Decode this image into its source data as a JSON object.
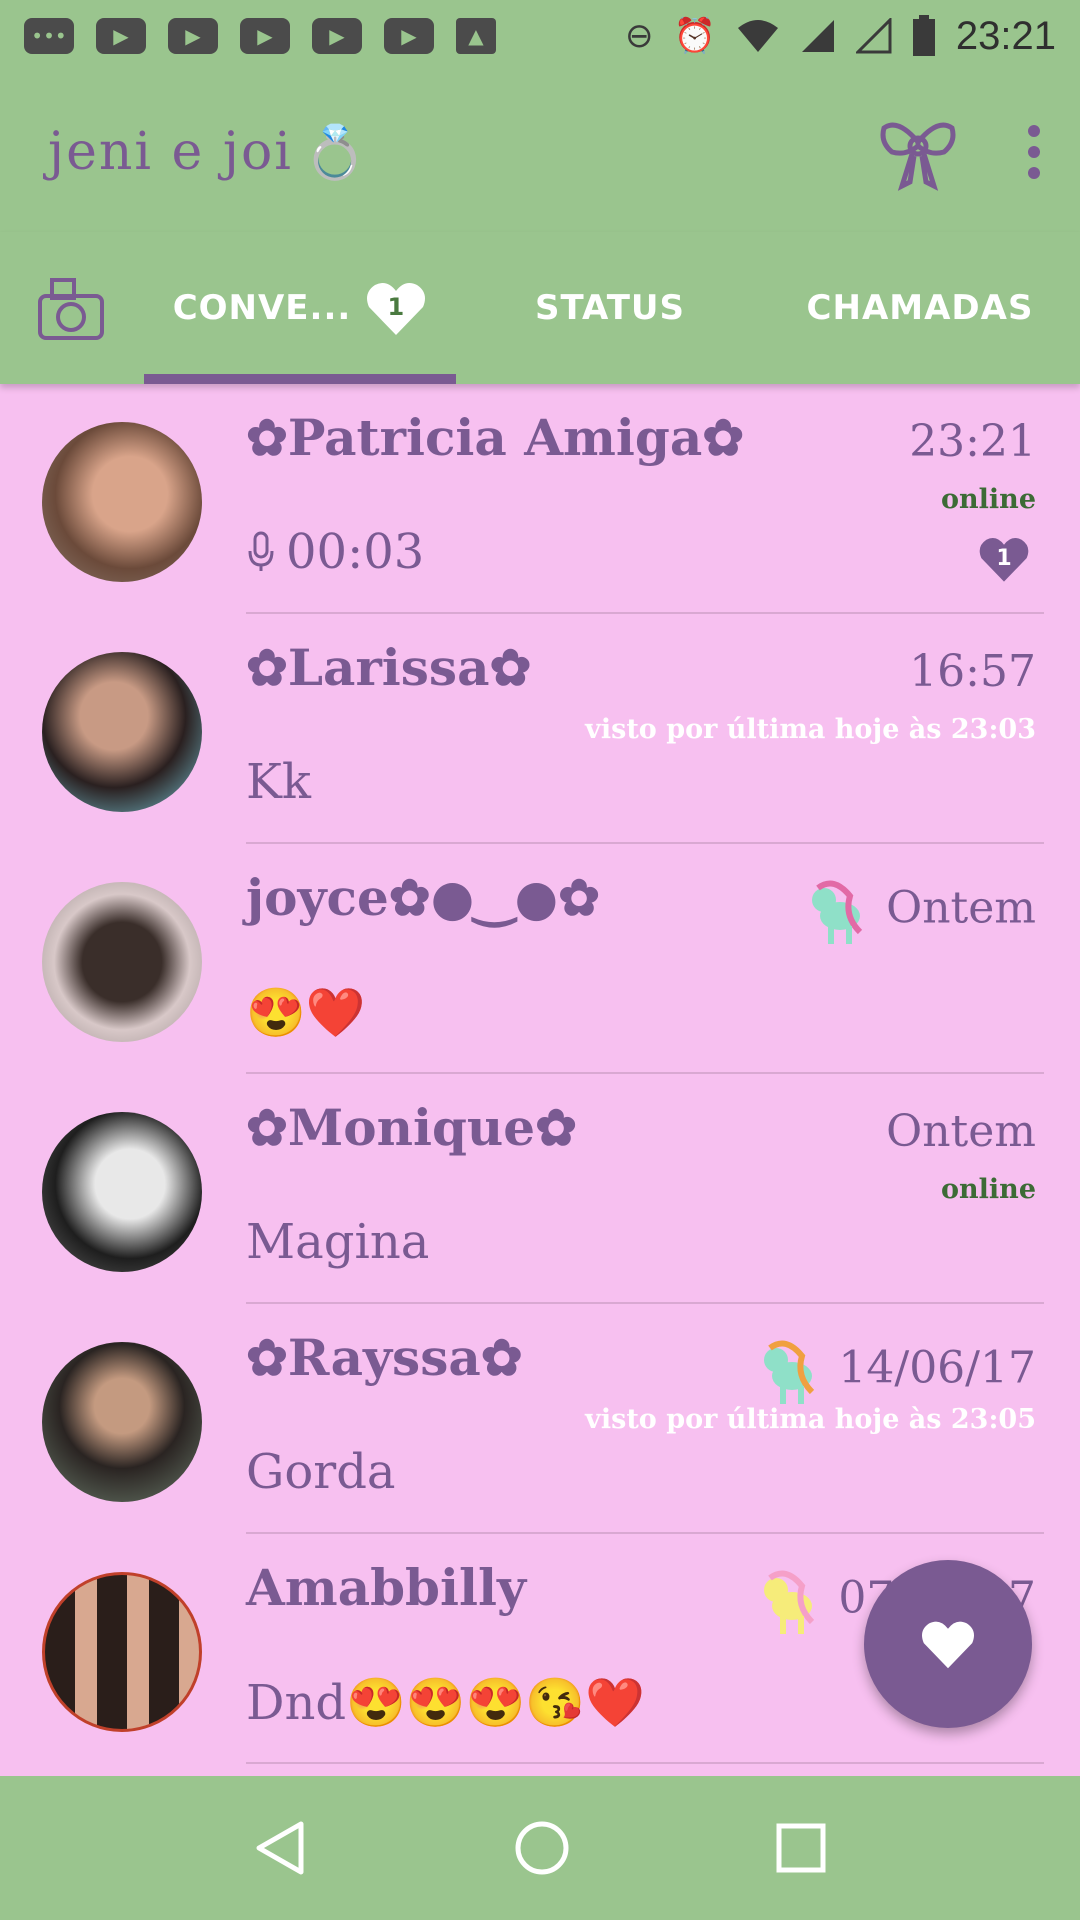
{
  "status_bar": {
    "time": "23:21",
    "left_icons": [
      "messenger-icon",
      "youtube-icon",
      "youtube-icon",
      "youtube-icon",
      "youtube-icon",
      "youtube-icon",
      "gallery-icon"
    ],
    "right_icons": [
      "do-not-disturb-icon",
      "alarm-icon",
      "wifi-icon",
      "signal-icon",
      "signal-empty-icon",
      "battery-icon"
    ]
  },
  "app_bar": {
    "title": "jeni e joi",
    "title_emoji": "💍",
    "actions": [
      "bow-icon",
      "more-options-icon"
    ]
  },
  "tabs": {
    "items": [
      {
        "label": "CONVE...",
        "badge": "1",
        "selected": true
      },
      {
        "label": "STATUS",
        "selected": false
      },
      {
        "label": "CHAMADAS",
        "selected": false
      }
    ]
  },
  "chats": [
    {
      "name": "✿Patricia Amiga✿",
      "time": "23:21",
      "presence": "online",
      "message": "00:03",
      "message_icon": "microphone-icon",
      "unread": "1"
    },
    {
      "name": "✿Larissa✿",
      "time": "16:57",
      "last_seen": "visto por última hoje às 23:03",
      "message": "Kk"
    },
    {
      "name": "joyce✿●‿●✿",
      "time": "Ontem",
      "sticker": "pony-icon",
      "message": "😍❤️"
    },
    {
      "name": "✿Monique✿",
      "time": "Ontem",
      "presence": "online",
      "message": "Magina"
    },
    {
      "name": "✿Rayssa✿",
      "time": "14/06/17",
      "sticker": "pony-icon",
      "last_seen": "visto por última hoje às 23:05",
      "message": "Gorda"
    },
    {
      "name": "Amabbilly",
      "time": "07/06/17",
      "sticker": "pony-icon",
      "message": "Dnd😍😍😍😘❤️"
    }
  ],
  "colors": {
    "header_bg": "#9ac58e",
    "list_bg": "#f7c0f0",
    "accent": "#7a5a92",
    "online": "#3d6b36"
  },
  "fab": {
    "icon": "heart-chat-icon"
  },
  "nav_bar": [
    "back-icon",
    "home-icon",
    "recents-icon"
  ]
}
